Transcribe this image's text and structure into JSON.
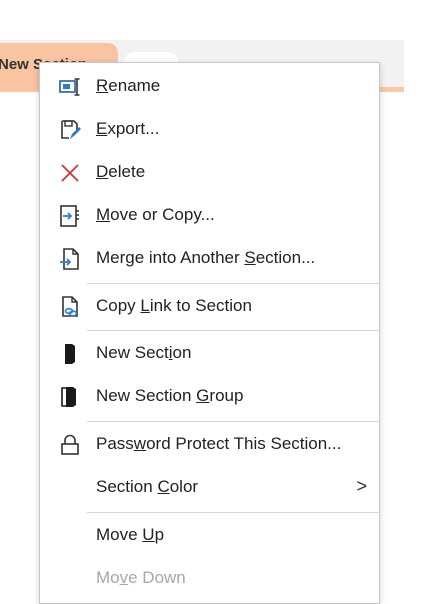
{
  "tab": {
    "label": "New Section"
  },
  "menu": {
    "items": [
      {
        "key": "rename",
        "pre": "",
        "acc": "R",
        "post": "ename",
        "icon": "rename-icon"
      },
      {
        "key": "export",
        "pre": "",
        "acc": "E",
        "post": "xport...",
        "icon": "export-icon"
      },
      {
        "key": "delete",
        "pre": "",
        "acc": "D",
        "post": "elete",
        "icon": "delete-icon"
      },
      {
        "key": "move-copy",
        "pre": "",
        "acc": "M",
        "post": "ove or Copy...",
        "icon": "move-copy-icon"
      },
      {
        "key": "merge",
        "pre": "Merge into Another ",
        "acc": "S",
        "post": "ection...",
        "icon": "merge-icon"
      },
      {
        "key": "copy-link",
        "pre": "Copy ",
        "acc": "L",
        "post": "ink to Section",
        "icon": "copy-link-icon"
      },
      {
        "key": "new-section",
        "pre": "New Sect",
        "acc": "i",
        "post": "on",
        "icon": "new-section-icon"
      },
      {
        "key": "new-section-group",
        "pre": "New Section ",
        "acc": "G",
        "post": "roup",
        "icon": "new-section-group-icon"
      },
      {
        "key": "password",
        "pre": "Pass",
        "acc": "w",
        "post": "ord Protect This Section...",
        "icon": "lock-icon"
      },
      {
        "key": "section-color",
        "pre": "Section ",
        "acc": "C",
        "post": "olor",
        "icon": ""
      },
      {
        "key": "move-up",
        "pre": "Move ",
        "acc": "U",
        "post": "p",
        "icon": ""
      },
      {
        "key": "move-down",
        "pre": "Mo",
        "acc": "v",
        "post": "e Down",
        "icon": ""
      }
    ],
    "submenu_chevron": ">"
  },
  "colors": {
    "tab": "#f8c4a2",
    "delete_icon": "#d13438",
    "accent_blue": "#2b7cd3",
    "disabled_text": "#a8a8a8"
  }
}
